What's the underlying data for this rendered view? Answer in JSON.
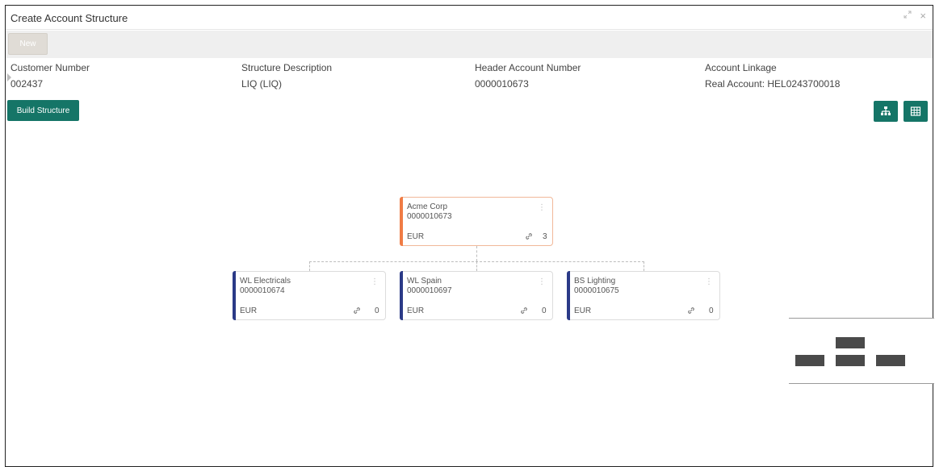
{
  "window": {
    "title": "Create Account Structure",
    "expand_icon": "expand-icon",
    "close_label": "×"
  },
  "toolbar": {
    "new_label": "New"
  },
  "meta": {
    "customer_number": {
      "label": "Customer Number",
      "value": "002437"
    },
    "structure_description": {
      "label": "Structure Description",
      "value": "LIQ (LIQ)"
    },
    "header_account_number": {
      "label": "Header Account Number",
      "value": "0000010673"
    },
    "account_linkage": {
      "label": "Account Linkage",
      "value": "Real Account: HEL0243700018"
    }
  },
  "actions": {
    "build_structure_label": "Build Structure",
    "tree_view_icon": "org-chart-icon",
    "table_view_icon": "grid-icon"
  },
  "tree": {
    "root": {
      "name": "Acme Corp",
      "account": "0000010673",
      "currency": "EUR",
      "count": "3",
      "accent": "#f07c45"
    },
    "children": [
      {
        "name": "WL Electricals",
        "account": "0000010674",
        "currency": "EUR",
        "count": "0",
        "accent": "#2b3a87"
      },
      {
        "name": "WL Spain",
        "account": "0000010697",
        "currency": "EUR",
        "count": "0",
        "accent": "#2b3a87"
      },
      {
        "name": "BS Lighting",
        "account": "0000010675",
        "currency": "EUR",
        "count": "0",
        "accent": "#2b3a87"
      }
    ]
  },
  "colors": {
    "primary_button": "#157567",
    "root_accent": "#f07c45",
    "child_accent": "#2b3a87"
  }
}
